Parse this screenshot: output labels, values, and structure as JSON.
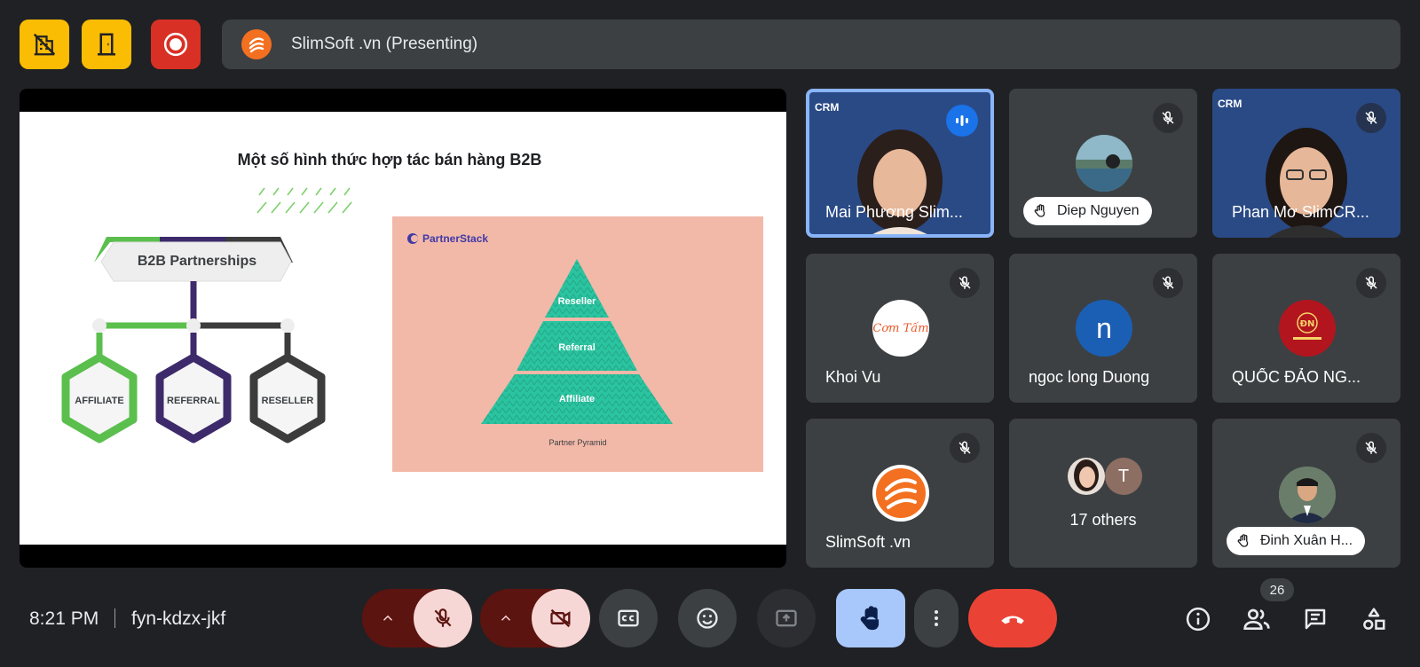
{
  "header": {
    "presenting_title": "SlimSoft .vn (Presenting)",
    "buttons": [
      "host-controls",
      "leave-breakout",
      "recording"
    ]
  },
  "slide": {
    "title": "Một số hình thức hợp tác bán hàng B2B",
    "b2b_label": "B2B Partnerships",
    "hexagons": [
      "AFFILIATE",
      "REFERRAL",
      "RESELLER"
    ],
    "brand": "PartnerStack",
    "pyramid": [
      "Reseller",
      "Referral",
      "Affiliate"
    ],
    "pyramid_caption": "Partner Pyramid"
  },
  "participants": [
    {
      "name": "Mai Phương Slim...",
      "video": true,
      "overlay": "CRM",
      "speaking": true,
      "active": true
    },
    {
      "name": "Diep Nguyen",
      "hand_raised": true,
      "muted": true
    },
    {
      "name": "Phan Mơ SlimCR...",
      "video": true,
      "overlay": "CRM",
      "muted": true
    },
    {
      "name": "Khoi Vu",
      "avatar_text": "Cơm Tấm",
      "avatar_color": "#ffffff",
      "muted": true
    },
    {
      "name": "ngoc long Duong",
      "avatar_letter": "n",
      "avatar_color": "#1a5fb4",
      "muted": true
    },
    {
      "name": "QUỐC ĐẢO NG...",
      "avatar_text": "ĐN",
      "avatar_color": "#b3151e",
      "muted": true
    },
    {
      "name": "SlimSoft .vn",
      "avatar_color": "#f37021",
      "muted": true
    },
    {
      "name": "17 others",
      "avatar_letter": "T",
      "avatar_color": "#8d6e63"
    },
    {
      "name": "Đinh Xuân H...",
      "hand_raised": true,
      "muted": true
    }
  ],
  "footer": {
    "time": "8:21 PM",
    "meeting_code": "fyn-kdzx-jkf",
    "people_count": "26"
  },
  "colors": {
    "accent_red": "#ea4335",
    "hand_blue": "#a8c7fa",
    "affiliate_green": "#5bbf4e",
    "referral_purple": "#3d2a6b",
    "reseller_dark": "#3c3c3c",
    "pyramid_teal": "#2bc4a0"
  }
}
